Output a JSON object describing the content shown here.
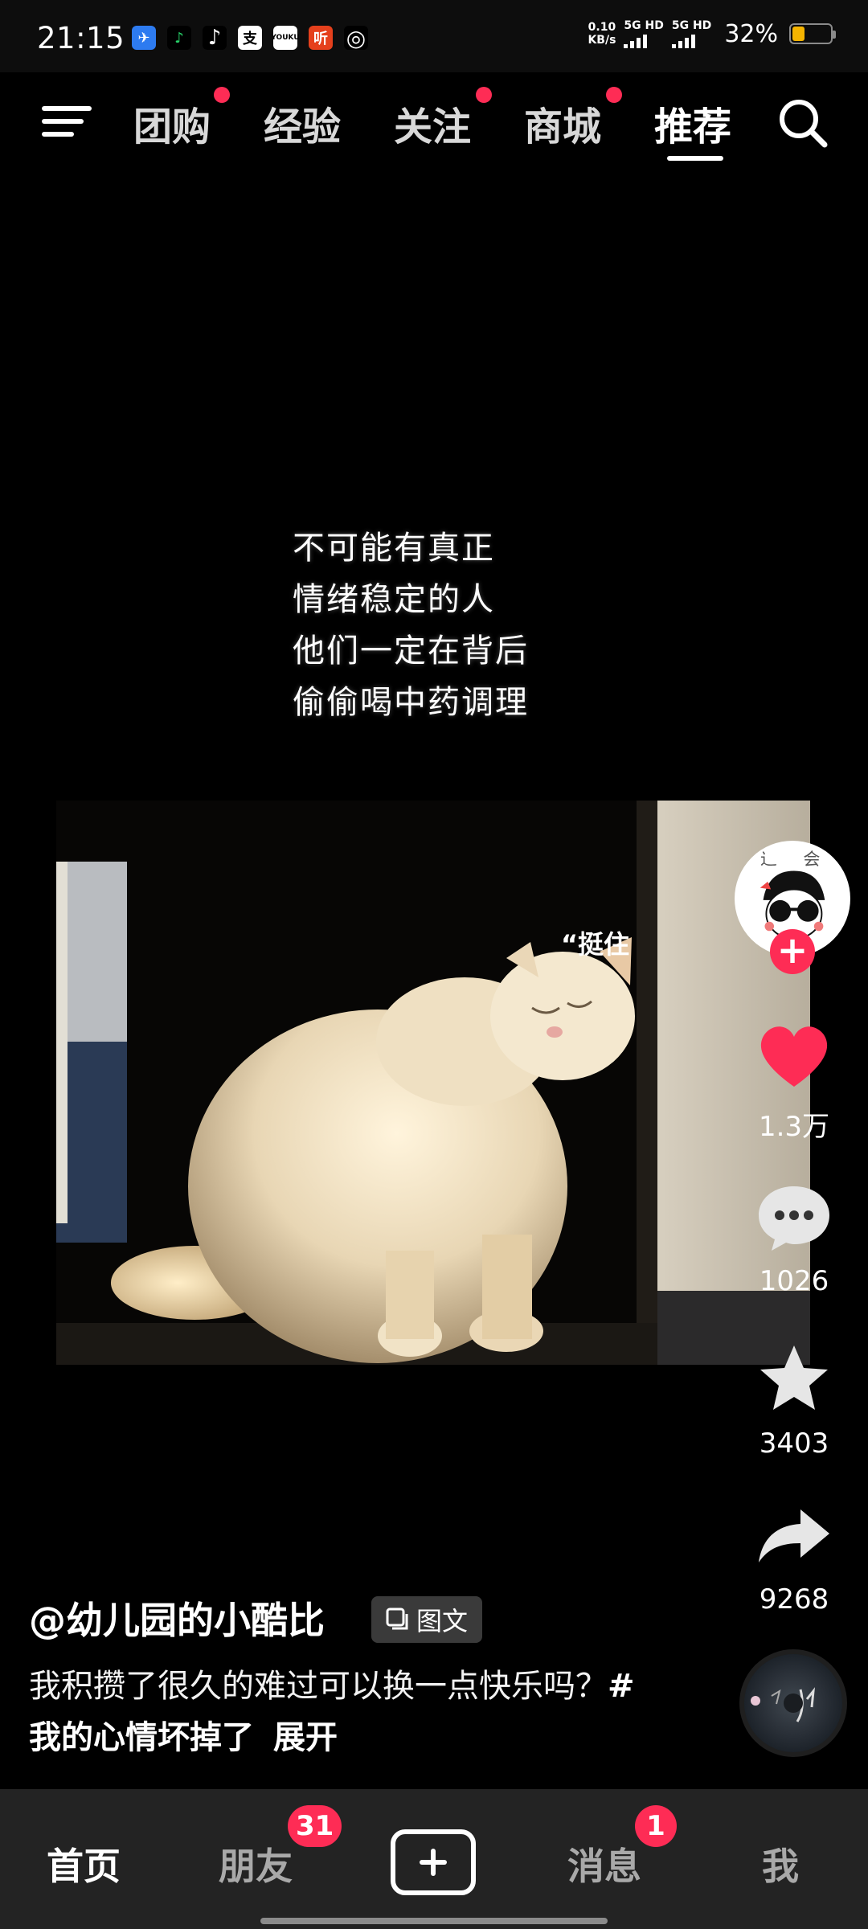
{
  "status_bar": {
    "time": "21:15",
    "app_icons": [
      "message-app-icon",
      "green-app-icon",
      "tiktok-icon",
      "alipay-icon",
      "youku-icon",
      "ting-app-icon",
      "netease-music-icon"
    ],
    "net_speed_value": "0.10",
    "net_speed_unit": "KB/s",
    "signal_1": "5G HD",
    "signal_2": "5G HD",
    "battery_percent": "32%",
    "battery_level": 0.32,
    "battery_color": "#f5b400"
  },
  "top_nav": {
    "tabs": [
      {
        "label": "团购",
        "dot": true
      },
      {
        "label": "经验",
        "dot": false
      },
      {
        "label": "关注",
        "dot": true
      },
      {
        "label": "商城",
        "dot": true
      },
      {
        "label": "推荐",
        "dot": false,
        "active": true
      }
    ],
    "dot_color": "#fe2c55"
  },
  "post": {
    "mood_text": [
      "不可能有真正",
      "情绪稳定的人",
      "他们一定在背后",
      "偷偷喝中药调理"
    ],
    "photo_caption": "挺住",
    "author": "@幼儿园的小酷比",
    "tag_label": "图文",
    "description": "我积攒了很久的难过可以换一点快乐吗？",
    "hashtag": "#我的心情坏掉了",
    "expand_label": "展开"
  },
  "actions": {
    "likes": "1.3万",
    "comments": "1026",
    "favorites": "3403",
    "shares": "9268",
    "like_color": "#fe2c55"
  },
  "bottom_nav": {
    "home": "首页",
    "friends": "朋友",
    "friends_badge": "31",
    "messages": "消息",
    "messages_badge": "1",
    "me": "我"
  }
}
